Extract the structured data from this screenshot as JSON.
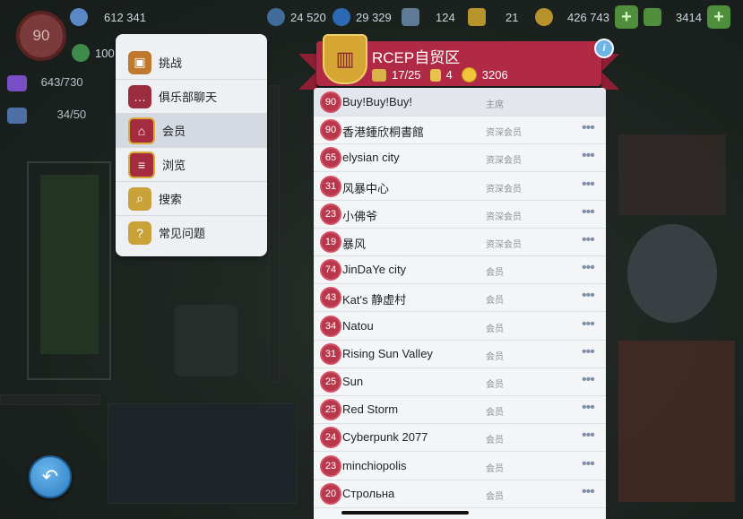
{
  "hud": {
    "level": "90",
    "population": "612 341",
    "population_icon": "people-icon",
    "sim_cash_small": "100",
    "storage": "643/730",
    "workers": "34/50",
    "neo_simoleons": "24 520",
    "simoleons_blue": "29 329",
    "golden_keys_shovel": "124",
    "keys": "21",
    "simoleons": "426 743",
    "simcash": "3414"
  },
  "menu": {
    "items": [
      {
        "label": "挑战",
        "icon": "treasure-chest-icon"
      },
      {
        "label": "俱乐部聊天",
        "icon": "chat-bubble-icon"
      },
      {
        "label": "会员",
        "icon": "club-shield-icon"
      },
      {
        "label": "浏览",
        "icon": "browse-shield-icon"
      },
      {
        "label": "搜索",
        "icon": "search-icon"
      },
      {
        "label": "常见问题",
        "icon": "faq-book-icon"
      }
    ],
    "active_index": 2
  },
  "club": {
    "name": "RCEP自贸区",
    "members": "17/25",
    "trophies": "4",
    "points": "3206",
    "banner_color": "#b02a45"
  },
  "members": [
    {
      "level": "90",
      "name": "Buy!Buy!Buy!",
      "role": "主席",
      "menu": ""
    },
    {
      "level": "90",
      "name": "香港鍾欣桐書館",
      "role": "资深会员",
      "menu": "•••"
    },
    {
      "level": "65",
      "name": "elysian city",
      "role": "资深会员",
      "menu": "•••"
    },
    {
      "level": "31",
      "name": "风暴中心",
      "role": "资深会员",
      "menu": "•••"
    },
    {
      "level": "23",
      "name": "小佛爷",
      "role": "资深会员",
      "menu": "•••"
    },
    {
      "level": "19",
      "name": "暴风",
      "role": "资深会员",
      "menu": "•••"
    },
    {
      "level": "74",
      "name": "JinDaYe city",
      "role": "会员",
      "menu": "•••"
    },
    {
      "level": "43",
      "name": "Kat's 静虚村",
      "role": "会员",
      "menu": "•••"
    },
    {
      "level": "34",
      "name": "Natou",
      "role": "会员",
      "menu": "•••"
    },
    {
      "level": "31",
      "name": "Rising Sun Valley",
      "role": "会员",
      "menu": "•••"
    },
    {
      "level": "25",
      "name": "Sun",
      "role": "会员",
      "menu": "•••"
    },
    {
      "level": "25",
      "name": "Red Storm",
      "role": "会员",
      "menu": "•••"
    },
    {
      "level": "24",
      "name": "Cyberpunk 2077",
      "role": "会员",
      "menu": "•••"
    },
    {
      "level": "23",
      "name": "minchiopolis",
      "role": "会员",
      "menu": "•••"
    },
    {
      "level": "20",
      "name": "Строльна",
      "role": "会员",
      "menu": "•••"
    }
  ],
  "back_icon": "back-arrow-icon"
}
